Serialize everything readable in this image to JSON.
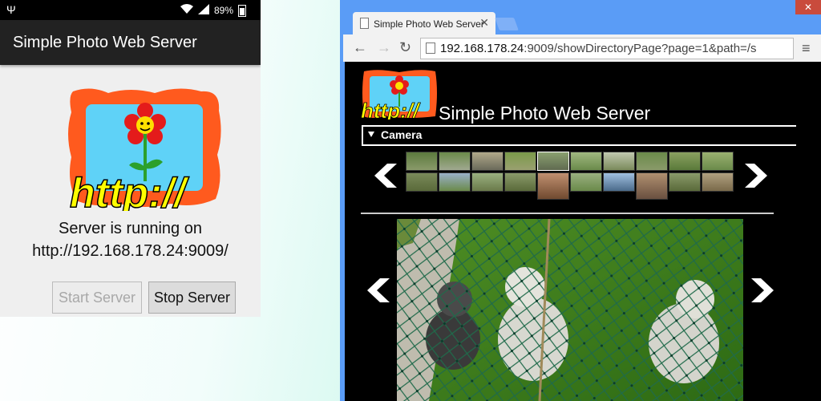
{
  "phone": {
    "status": {
      "battery": "89%"
    },
    "app_title": "Simple Photo Web Server",
    "status_line1": "Server is running on",
    "status_line2": "http://192.168.178.24:9009/",
    "start_label": "Start Server",
    "stop_label": "Stop Server"
  },
  "browser": {
    "tab_title": "Simple Photo Web Server",
    "url_host": "192.168.178.24",
    "url_rest": ":9009/showDirectoryPage?page=1&path=/s",
    "page_title": "Simple Photo Web Server",
    "album_name": "Camera"
  },
  "colors": {
    "logo_frame": "#ff5a1e",
    "logo_sky": "#5fd2f7",
    "logo_text": "#ffff00",
    "browser_chrome": "#5a9cf6",
    "page_bg": "#000000"
  }
}
